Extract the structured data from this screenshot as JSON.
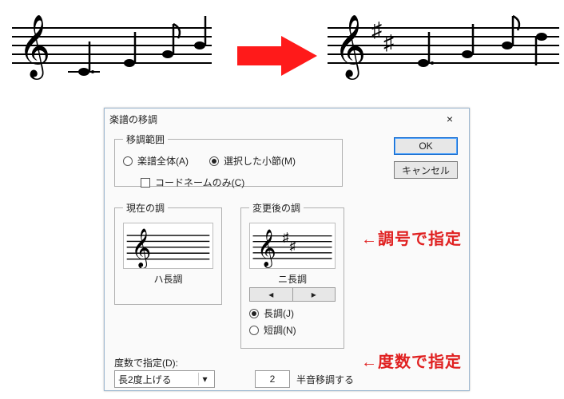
{
  "dialog": {
    "title": "楽譜の移調",
    "close_icon": "×",
    "range": {
      "legend": "移調範囲",
      "all_label": "楽譜全体(A)",
      "selected_label": "選択した小節(M)",
      "chordnames_only_label": "コードネームのみ(C)",
      "all_selected": false,
      "selected_selected": true,
      "chordnames_checked": false
    },
    "current_key": {
      "legend": "現在の調",
      "name": "ハ長調"
    },
    "post_key": {
      "legend": "変更後の調",
      "name": "ニ長調",
      "prev_glyph": "◂",
      "next_glyph": "▸",
      "major_label": "長調(J)",
      "minor_label": "短調(N)",
      "major_selected": true,
      "minor_selected": false
    },
    "degree": {
      "label": "度数で指定(D):",
      "select_value": "長2度上げる",
      "dropdown_glyph": "▾",
      "semitones_value": "2",
      "semitones_label": "半音移調する"
    },
    "buttons": {
      "ok": "OK",
      "cancel": "キャンセル"
    }
  },
  "annotations": {
    "key_arrow": "←調号で指定",
    "degree_arrow": "←度数で指定"
  },
  "top": {
    "arrow_glyph": "→"
  }
}
